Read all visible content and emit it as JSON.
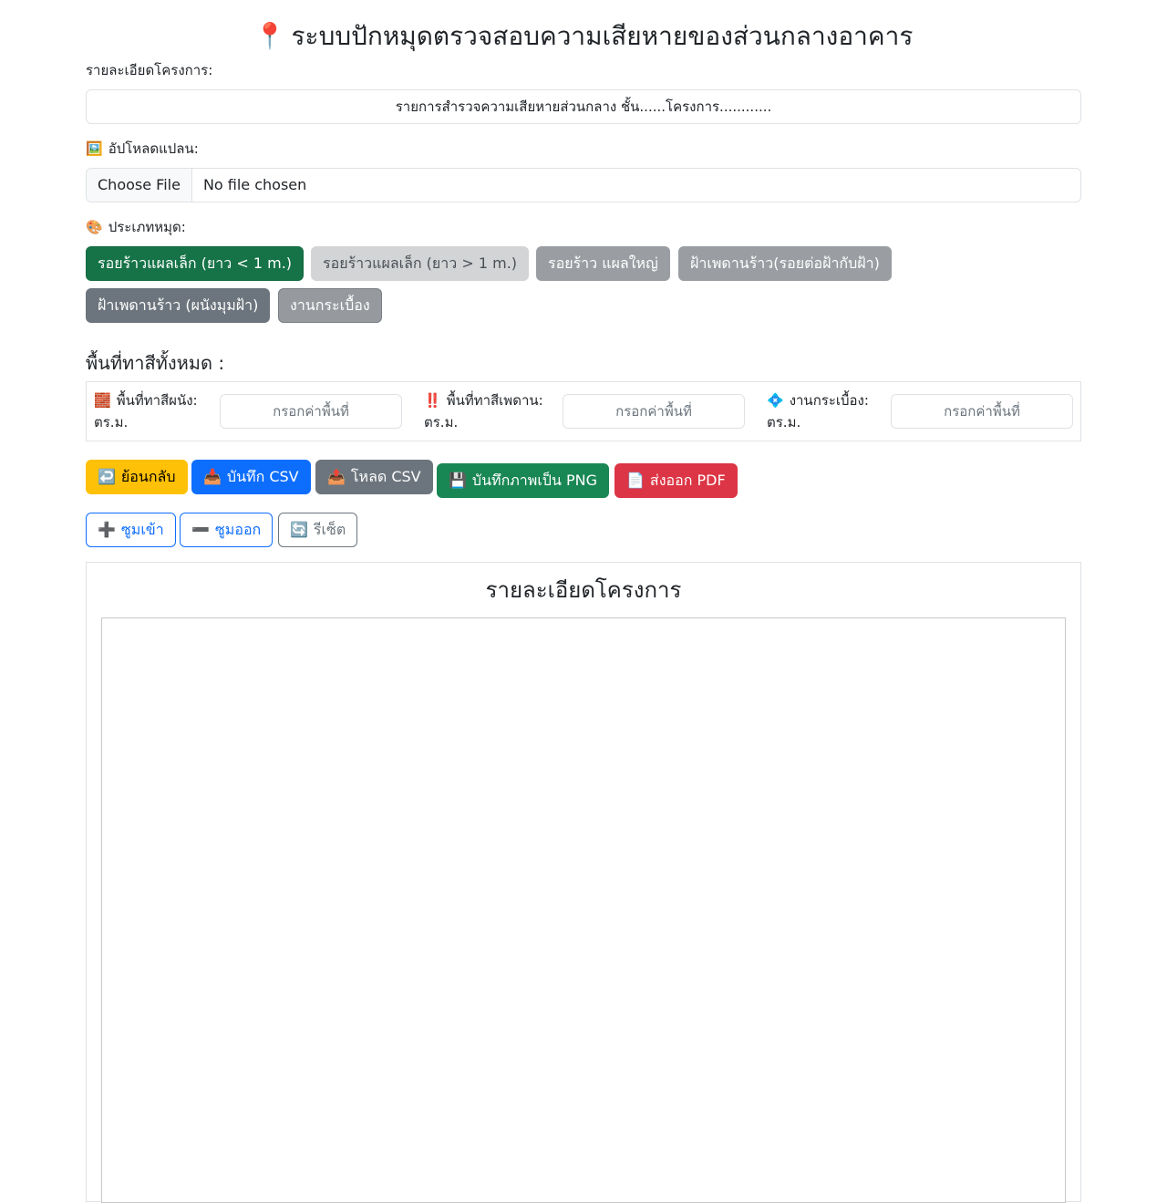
{
  "header": {
    "icon": "📍",
    "title": "ระบบปักหมุดตรวจสอบความเสียหายของส่วนกลางอาคาร"
  },
  "project": {
    "label": "รายละเอียดโครงการ:",
    "value": "รายการสำรวจความเสียหายส่วนกลาง ชั้น......โครงการ............"
  },
  "upload": {
    "icon": "🖼️",
    "label": "อัปโหลดแปลน:",
    "button": "Choose File",
    "status": "No file chosen"
  },
  "pin_types": {
    "icon": "🎨",
    "label": "ประเภทหมุด:",
    "items": [
      "รอยร้าวแผลเล็ก (ยาว < 1 m.)",
      "รอยร้าวแผลเล็ก (ยาว > 1 m.)",
      "รอยร้าว แผลใหญ่",
      "ฝ้าเพดานร้าว(รอยต่อฝ้ากับฝ้า)",
      "ฝ้าเพดานร้าว (ผนังมุมฝ้า)",
      "งานกระเบื้อง"
    ],
    "colors": [
      "#157347",
      "#d3d4d5",
      "#9a9ea2",
      "#9a9ea2",
      "#6c757d",
      "#969a9e"
    ]
  },
  "area": {
    "heading": "พื้นที่ทาสีทั้งหมด :",
    "fields": [
      {
        "icon": "🧱",
        "label": "พื้นที่ทาสีผนัง:",
        "unit": "ตร.ม.",
        "placeholder": "กรอกค่าพื้นที่"
      },
      {
        "icon": "‼️",
        "label": "พื้นที่ทาสีเพดาน:",
        "unit": "ตร.ม.",
        "placeholder": "กรอกค่าพื้นที่"
      },
      {
        "icon": "💠",
        "label": "งานกระเบื้อง:",
        "unit": "ตร.ม.",
        "placeholder": "กรอกค่าพื้นที่"
      }
    ]
  },
  "actions": {
    "back": {
      "icon": "↩️",
      "label": "ย้อนกลับ"
    },
    "save_csv": {
      "icon": "📥",
      "label": "บันทึก CSV"
    },
    "load_csv": {
      "icon": "📤",
      "label": "โหลด CSV"
    },
    "save_png": {
      "icon": "💾",
      "label": "บันทึกภาพเป็น PNG"
    },
    "export_pdf": {
      "icon": "📄",
      "label": "ส่งออก PDF"
    }
  },
  "zoom": {
    "in": {
      "icon": "➕",
      "label": "ซูมเข้า"
    },
    "out": {
      "icon": "➖",
      "label": "ซูมออก"
    },
    "reset": {
      "icon": "🔄",
      "label": "รีเซ็ต"
    }
  },
  "canvas": {
    "title": "รายละเอียดโครงการ"
  }
}
